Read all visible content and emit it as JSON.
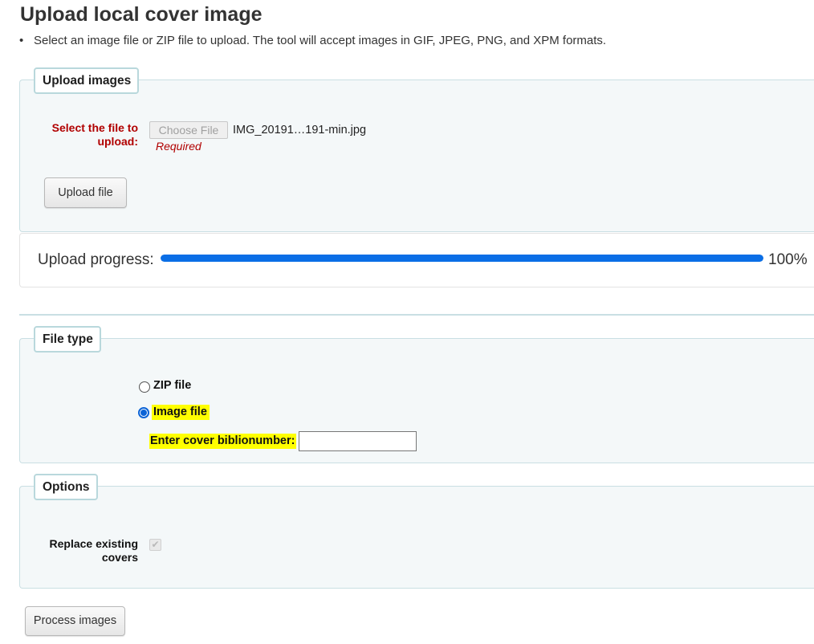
{
  "page": {
    "title": "Upload local cover image",
    "hint": "Select an image file or ZIP file to upload. The tool will accept images in GIF, JPEG, PNG, and XPM formats."
  },
  "upload_images": {
    "legend": "Upload images",
    "file_label_line1": "Select the file to",
    "file_label_line2": "upload:",
    "choose_file_label": "Choose File",
    "selected_file": "IMG_20191…191-min.jpg",
    "required_text": "Required",
    "upload_button": "Upload file"
  },
  "progress": {
    "label": "Upload progress:",
    "value": 1.0,
    "percent_text": "100%",
    "fill_color": "#0a6ee6"
  },
  "file_type": {
    "legend": "File type",
    "options": [
      {
        "label": "ZIP file",
        "selected": false
      },
      {
        "label": "Image file",
        "selected": true
      }
    ],
    "biblionumber_label": "Enter cover biblionumber:",
    "biblionumber_value": ""
  },
  "options": {
    "legend": "Options",
    "replace_label_line1": "Replace existing",
    "replace_label_line2": "covers",
    "replace_checked": true,
    "replace_disabled": true
  },
  "actions": {
    "process_button": "Process images"
  },
  "colors": {
    "required_red": "#b10000",
    "highlight_yellow": "#ffff00",
    "fieldset_bg": "#f4f8f9",
    "fieldset_border": "#c9dfe3"
  },
  "icons": {
    "bullet": "bullet-icon",
    "checkmark": "checkmark-icon"
  }
}
